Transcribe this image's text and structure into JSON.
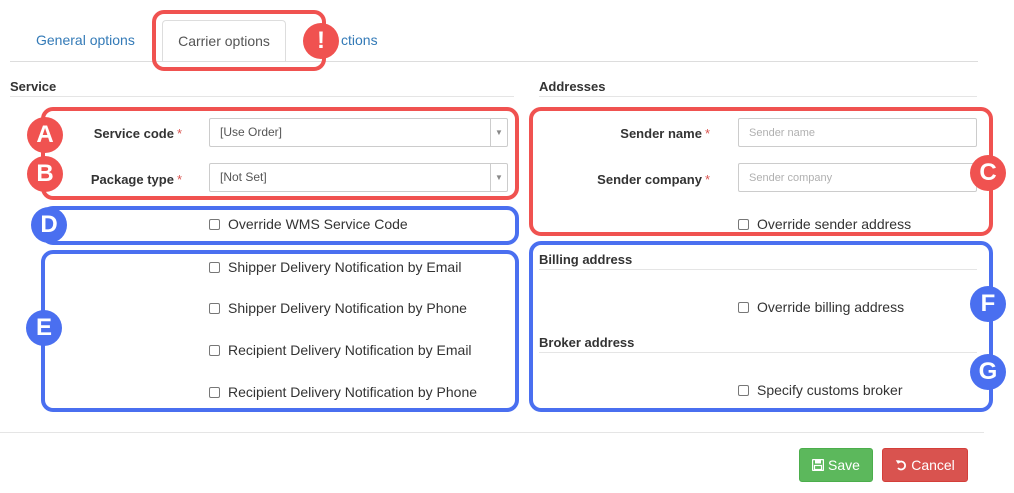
{
  "tabs": {
    "general": "General options",
    "carrier": "Carrier options",
    "instructions_fragment": "ctions"
  },
  "service": {
    "title": "Service",
    "service_code_label": "Service code",
    "service_code_value": "[Use Order]",
    "package_type_label": "Package type",
    "package_type_value": "[Not Set]",
    "required_mark": "*",
    "override_wms": "Override WMS Service Code",
    "notifications": [
      "Shipper Delivery Notification by Email",
      "Shipper Delivery Notification by Phone",
      "Recipient Delivery Notification by Email",
      "Recipient Delivery Notification by Phone"
    ]
  },
  "addresses": {
    "title": "Addresses",
    "sender_name_label": "Sender name",
    "sender_name_placeholder": "Sender name",
    "sender_company_label": "Sender company",
    "sender_company_placeholder": "Sender company",
    "override_sender": "Override sender address",
    "billing_title": "Billing address",
    "override_billing": "Override billing address",
    "broker_title": "Broker address",
    "specify_broker": "Specify customs broker"
  },
  "annotations": {
    "exclamation": "!",
    "a": "A",
    "b": "B",
    "c": "C",
    "d": "D",
    "e": "E",
    "f": "F",
    "g": "G",
    "red_color": "#f05250",
    "blue_color": "#4a6ff0"
  },
  "footer": {
    "save": "Save",
    "cancel": "Cancel",
    "save_icon": "floppy-disk-icon",
    "cancel_icon": "undo-icon"
  }
}
